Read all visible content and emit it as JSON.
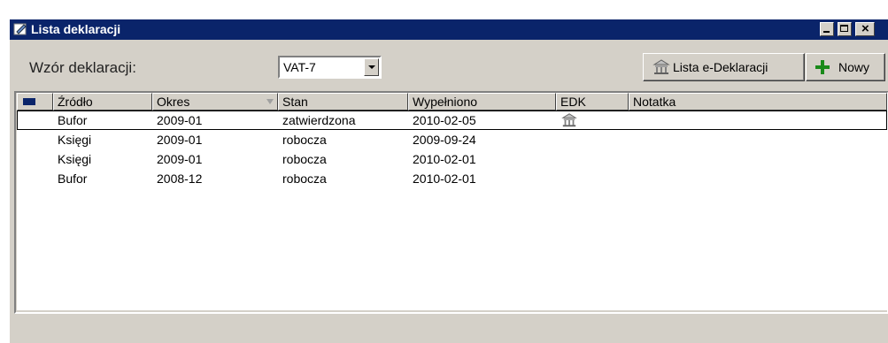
{
  "window": {
    "title": "Lista deklaracji",
    "accent_color": "#0a246a"
  },
  "toolbar": {
    "template_label": "Wzór deklaracji:",
    "template_value": "VAT-7",
    "lista_button_label": "Lista e-Deklaracji",
    "nowy_button_label": "Nowy"
  },
  "table": {
    "columns": [
      "Źródło",
      "Okres",
      "Stan",
      "Wypełniono",
      "EDK",
      "Notatka"
    ],
    "rows": [
      {
        "zrodlo": "Bufor",
        "okres": "2009-01",
        "stan": "zatwierdzona",
        "wypelniono": "2010-02-05",
        "edk_icon": "e-declaration-icon",
        "notatka": ""
      },
      {
        "zrodlo": "Księgi",
        "okres": "2009-01",
        "stan": "robocza",
        "wypelniono": "2009-09-24",
        "edk_icon": "",
        "notatka": ""
      },
      {
        "zrodlo": "Księgi",
        "okres": "2009-01",
        "stan": "robocza",
        "wypelniono": "2010-02-01",
        "edk_icon": "",
        "notatka": ""
      },
      {
        "zrodlo": "Bufor",
        "okres": "2008-12",
        "stan": "robocza",
        "wypelniono": "2010-02-01",
        "edk_icon": "",
        "notatka": ""
      }
    ]
  }
}
